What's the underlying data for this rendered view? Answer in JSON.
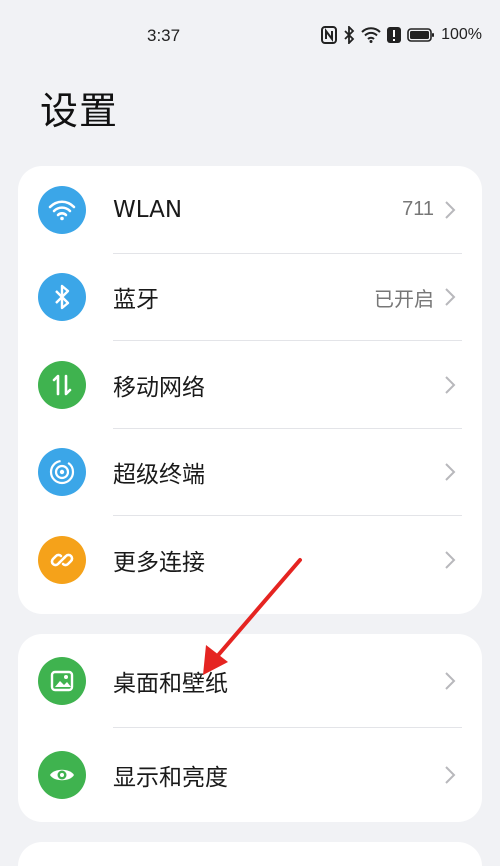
{
  "status_bar": {
    "time": "3:37",
    "battery": "100%",
    "icons": [
      "nfc-icon",
      "bluetooth-icon",
      "wifi-icon",
      "alert-icon",
      "battery-icon"
    ]
  },
  "page": {
    "title": "设置"
  },
  "groups": [
    {
      "items": [
        {
          "label": "WLAN",
          "value": "711",
          "icon": "wifi-icon",
          "color": "#3ba6e8"
        },
        {
          "label": "蓝牙",
          "value": "已开启",
          "icon": "bluetooth-icon",
          "color": "#3ba6e8"
        },
        {
          "label": "移动网络",
          "value": "",
          "icon": "mobile-data-icon",
          "color": "#3fb34f"
        },
        {
          "label": "超级终端",
          "value": "",
          "icon": "super-device-icon",
          "color": "#3ba6e8"
        },
        {
          "label": "更多连接",
          "value": "",
          "icon": "link-icon",
          "color": "#f5a21a"
        }
      ]
    },
    {
      "items": [
        {
          "label": "桌面和壁纸",
          "value": "",
          "icon": "wallpaper-icon",
          "color": "#3fb34f"
        },
        {
          "label": "显示和亮度",
          "value": "",
          "icon": "eye-icon",
          "color": "#3fb34f"
        }
      ]
    }
  ],
  "annotation": {
    "arrow_color": "#e52421"
  }
}
